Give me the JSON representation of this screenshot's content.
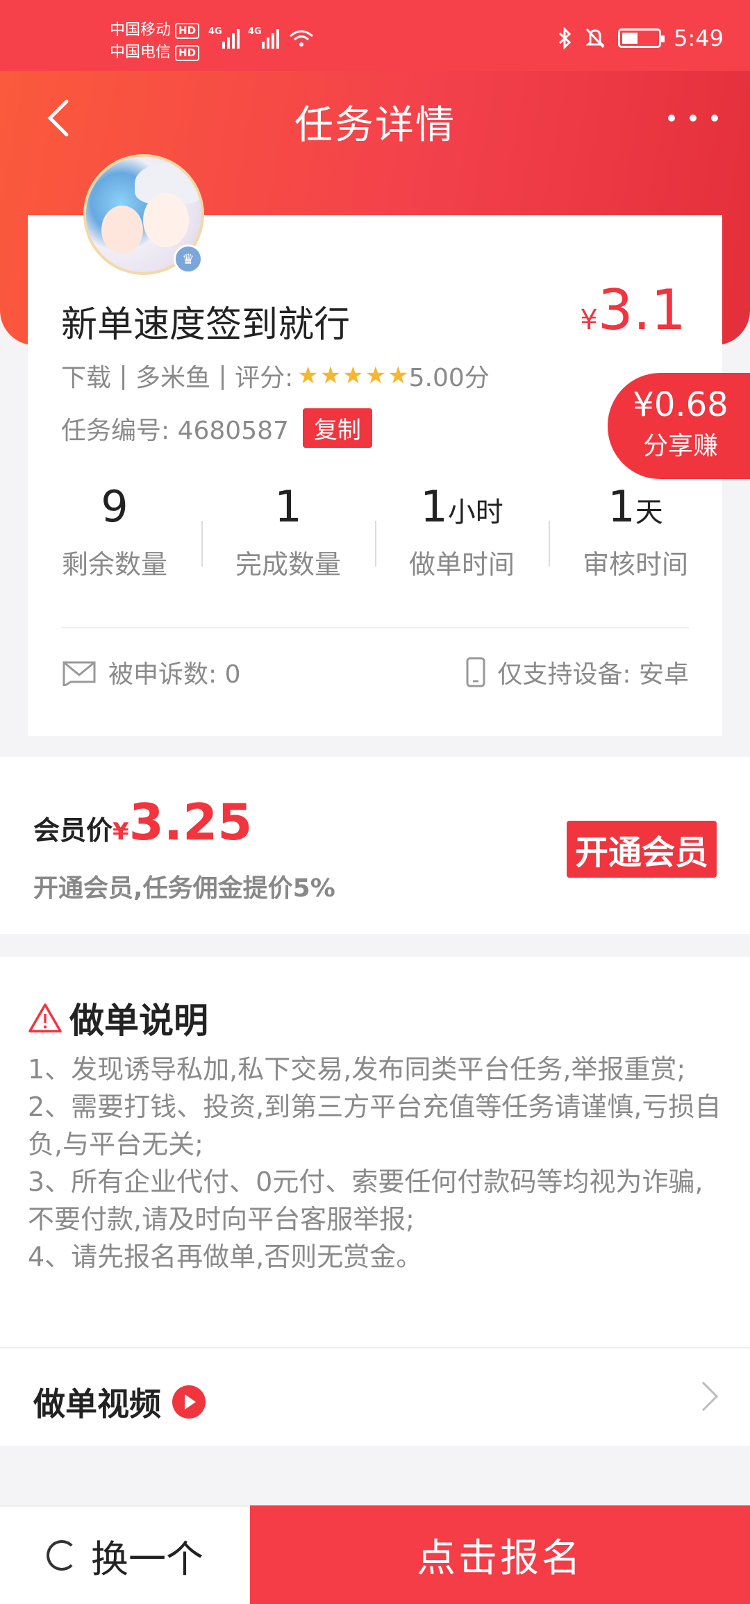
{
  "status_bar": {
    "carrier1": "中国移动",
    "carrier2": "中国电信",
    "hd": "HD",
    "network": "4G",
    "time": "5:49"
  },
  "header": {
    "title": "任务详情"
  },
  "task": {
    "title": "新单速度签到就行",
    "price_symbol": "¥",
    "price": "3.1",
    "category": "下载",
    "publisher": "多米鱼",
    "rating_label": "评分:",
    "rating_stars": 5,
    "rating_text": "5.00分",
    "number_label": "任务编号:",
    "number": "4680587",
    "copy_label": "复制",
    "share": {
      "amount": "¥0.68",
      "label": "分享赚"
    },
    "stats": [
      {
        "value": "9",
        "unit": "",
        "label": "剩余数量"
      },
      {
        "value": "1",
        "unit": "",
        "label": "完成数量"
      },
      {
        "value": "1",
        "unit": "小时",
        "label": "做单时间"
      },
      {
        "value": "1",
        "unit": "天",
        "label": "审核时间"
      }
    ],
    "complaints_label": "被申诉数:",
    "complaints": "0",
    "device_label": "仅支持设备:",
    "device": "安卓"
  },
  "member": {
    "label": "会员价",
    "symbol": "¥",
    "price": "3.25",
    "desc": "开通会员,任务佣金提价5%",
    "button": "开通会员"
  },
  "instructions": {
    "title": "做单说明",
    "items": [
      "1、发现诱导私加,私下交易,发布同类平台任务,举报重赏;",
      "2、需要打钱、投资,到第三方平台充值等任务请谨慎,亏损自负,与平台无关;",
      "3、所有企业代付、0元付、索要任何付款码等均视为诈骗,不要付款,请及时向平台客服举报;",
      "4、请先报名再做单,否则无赏金。"
    ]
  },
  "video": {
    "label": "做单视频"
  },
  "bottom": {
    "switch_label": "换一个",
    "signup_label": "点击报名"
  },
  "colors": {
    "accent": "#f0353f",
    "star": "#f8b62d"
  }
}
